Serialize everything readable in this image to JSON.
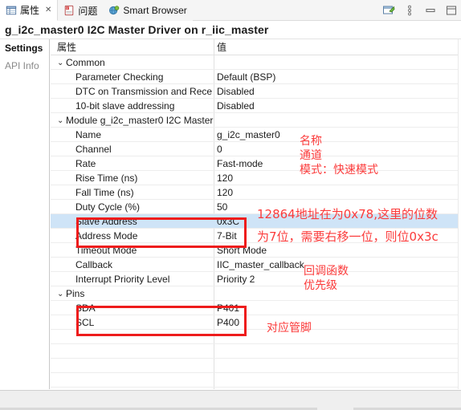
{
  "tabs": [
    {
      "label": "属性",
      "icon": "properties-icon",
      "closable": true,
      "active": true,
      "close_glyph": "✕"
    },
    {
      "label": "问题",
      "icon": "problems-icon",
      "closable": false,
      "active": false,
      "close_glyph": ""
    },
    {
      "label": "Smart Browser",
      "icon": "smart-browser-icon",
      "closable": false,
      "active": false,
      "close_glyph": ""
    }
  ],
  "toolbar": {
    "buttons": [
      {
        "name": "new-view-icon",
        "tooltip": "New"
      },
      {
        "name": "view-menu-icon",
        "tooltip": "View Menu"
      },
      {
        "name": "minimize-icon",
        "tooltip": "Minimize"
      },
      {
        "name": "maximize-icon",
        "tooltip": "Maximize"
      }
    ]
  },
  "page_title": "g_i2c_master0 I2C Master Driver on r_iic_master",
  "sidebar": {
    "items": [
      {
        "label": "Settings",
        "selected": true
      },
      {
        "label": "API Info",
        "selected": false
      }
    ]
  },
  "table": {
    "headers": {
      "property": "属性",
      "value": "值"
    },
    "groups": [
      {
        "name": "Common",
        "expanded": true,
        "chevron": "⌄",
        "rows": [
          {
            "name": "Parameter Checking",
            "value": "Default (BSP)",
            "selected": false
          },
          {
            "name": "DTC on Transmission and Rece",
            "value": "Disabled",
            "selected": false
          },
          {
            "name": "10-bit slave addressing",
            "value": "Disabled",
            "selected": false
          }
        ]
      },
      {
        "name": "Module g_i2c_master0 I2C Master",
        "expanded": true,
        "chevron": "⌄",
        "rows": [
          {
            "name": "Name",
            "value": "g_i2c_master0",
            "selected": false
          },
          {
            "name": "Channel",
            "value": "0",
            "selected": false
          },
          {
            "name": "Rate",
            "value": "Fast-mode",
            "selected": false
          },
          {
            "name": "Rise Time (ns)",
            "value": "120",
            "selected": false
          },
          {
            "name": "Fall Time (ns)",
            "value": "120",
            "selected": false
          },
          {
            "name": "Duty Cycle (%)",
            "value": "50",
            "selected": false
          },
          {
            "name": "Slave Address",
            "value": "0x3C",
            "selected": true
          },
          {
            "name": "Address Mode",
            "value": "7-Bit",
            "selected": false
          },
          {
            "name": "Timeout Mode",
            "value": "Short Mode",
            "selected": false
          },
          {
            "name": "Callback",
            "value": "IIC_master_callback",
            "selected": false
          },
          {
            "name": "Interrupt Priority Level",
            "value": "Priority 2",
            "selected": false
          }
        ]
      },
      {
        "name": "Pins",
        "expanded": true,
        "chevron": "⌄",
        "rows": [
          {
            "name": "SDA",
            "value": "P401",
            "selected": false
          },
          {
            "name": "SCL",
            "value": "P400",
            "selected": false
          }
        ]
      }
    ],
    "empty_rows": 5
  },
  "annotations": {
    "color": "#fb3b3b",
    "box_color": "#ee1c1c",
    "notes": [
      {
        "id": "name-note",
        "text": "名称"
      },
      {
        "id": "channel-note",
        "text": "通道"
      },
      {
        "id": "rate-note",
        "text": "模式：快速模式"
      },
      {
        "id": "address-note-line1",
        "text": "12864地址在为0x78,这里的位数"
      },
      {
        "id": "address-note-line2",
        "text": "为7位，需要右移一位，则位0x3c"
      },
      {
        "id": "callback-note",
        "text": "回调函数"
      },
      {
        "id": "priority-note",
        "text": "优先级"
      },
      {
        "id": "pins-note",
        "text": "对应管脚"
      }
    ]
  }
}
